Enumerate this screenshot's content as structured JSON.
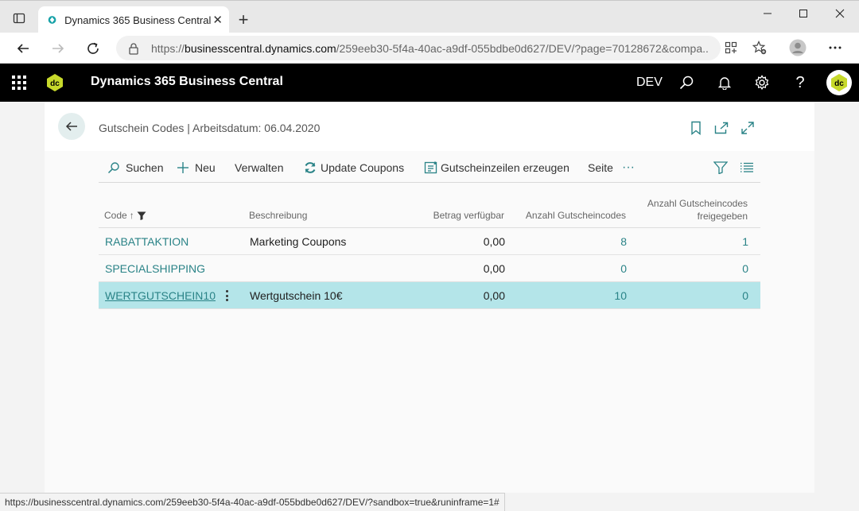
{
  "browser": {
    "tab_title": "Dynamics 365 Business Central",
    "url_prefix": "https://",
    "url_host": "businesscentral.dynamics.com",
    "url_path": "/259eeb30-5f4a-40ac-a9df-055bdbe0d627/DEV/?page=70128672&compa...",
    "status_url": "https://businesscentral.dynamics.com/259eeb30-5f4a-40ac-a9df-055bdbe0d627/DEV/?sandbox=true&runinframe=1#"
  },
  "header": {
    "app_title": "Dynamics 365 Business Central",
    "environment": "DEV"
  },
  "page": {
    "title": "Gutschein Codes | Arbeitsdatum: 06.04.2020"
  },
  "actions": {
    "search": "Suchen",
    "new": "Neu",
    "manage": "Verwalten",
    "update_coupons": "Update Coupons",
    "generate_lines": "Gutscheinzeilen erzeugen",
    "page": "Seite",
    "more": "···"
  },
  "columns": {
    "code": "Code",
    "code_sort": "↑",
    "description": "Beschreibung",
    "amount_available": "Betrag verfügbar",
    "count_codes": "Anzahl Gutscheincodes",
    "count_released_line1": "Anzahl Gutscheincodes",
    "count_released_line2": "freigegeben"
  },
  "rows": [
    {
      "code": "RABATTAKTION",
      "description": "Marketing Coupons",
      "amount": "0,00",
      "count": "8",
      "released": "1"
    },
    {
      "code": "SPECIALSHIPPING",
      "description": "",
      "amount": "0,00",
      "count": "0",
      "released": "0"
    },
    {
      "code": "WERTGUTSCHEIN10",
      "description": "Wertgutschein 10€",
      "amount": "0,00",
      "count": "10",
      "released": "0"
    }
  ],
  "colors": {
    "accent": "#2a8387",
    "selected_row": "#b4e5e9",
    "header_bg": "#000000"
  }
}
